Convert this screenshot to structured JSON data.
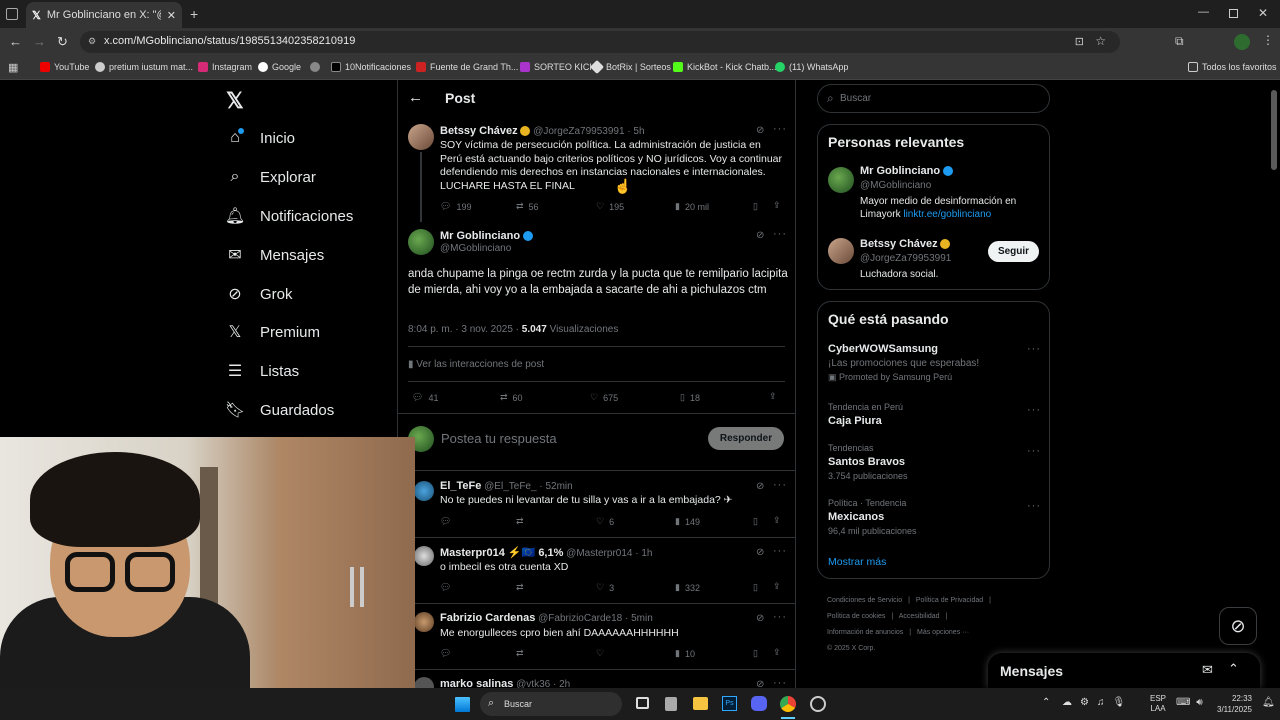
{
  "browser": {
    "tab_title": "Mr Goblinciano en X: \"@JorgeZ",
    "url": "x.com/MGoblinciano/status/1985513402358210919",
    "bookmarks": [
      "YouTube",
      "pretium iustum mat...",
      "Instagram",
      "Google",
      "",
      "10Notificaciones",
      "Fuente de Grand Th...",
      "SORTEO KICK",
      "BotRix | Sorteos",
      "KickBot - Kick Chatb...",
      "(11) WhatsApp"
    ],
    "all_bookmarks": "Todos los favoritos"
  },
  "nav": {
    "items": [
      "Inicio",
      "Explorar",
      "Notificaciones",
      "Mensajes",
      "Grok",
      "Premium",
      "Listas",
      "Guardados"
    ]
  },
  "header": {
    "title": "Post"
  },
  "parent_tweet": {
    "name": "Betssy Chávez",
    "handle": "@JorgeZa79953991",
    "time": "· 5h",
    "text": "SOY víctima de persecución política. La administración de justicia en Perú está actuando bajo criterios políticos y NO jurídicos. Voy a continuar defendiendo mis derechos en instancias nacionales e internacionales. LUCHARE HASTA EL FINAL",
    "replies": "199",
    "reposts": "56",
    "likes": "195",
    "views": "20 mil"
  },
  "main_tweet": {
    "name": "Mr Goblinciano",
    "handle": "@MGoblinciano",
    "text": "anda chupame la pinga oe rectm zurda y la pucta que te remilpario lacipita de mierda, ahi voy yo a la embajada a sacarte de ahi a pichulazos ctm",
    "timestamp": "8:04 p. m. · 3 nov. 2025 ·",
    "views_count": "5.047",
    "views_label": "Visualizaciones",
    "interactions": "Ver las interacciones de post",
    "replies": "41",
    "reposts": "60",
    "likes": "675",
    "bookmarks": "18"
  },
  "reply_box": {
    "placeholder": "Postea tu respuesta",
    "button": "Responder"
  },
  "replies": [
    {
      "name": "El_TeFe",
      "handle": "@El_TeFe_",
      "time": "· 52min",
      "text": "No te puedes ni levantar de tu silla y vas a ir a la embajada? ✈",
      "replies": "",
      "reposts": "",
      "likes": "6",
      "views": "149"
    },
    {
      "name": "Masterpr014 ⚡🇪🇺 6,1%",
      "handle": "@Masterpr014",
      "time": "· 1h",
      "text": "o imbecil es otra cuenta XD",
      "replies": "",
      "reposts": "",
      "likes": "3",
      "views": "332"
    },
    {
      "name": "Fabrizio Cardenas",
      "handle": "@FabrizioCarde18",
      "time": "· 5min",
      "text": "Me enorgulleces cpro bien ahí DAAAAAAHHHHHH",
      "replies": "",
      "reposts": "",
      "likes": "",
      "views": "10"
    },
    {
      "name": "marko salinas",
      "handle": "@vtk36",
      "time": "· 2h",
      "text": "",
      "replies": "",
      "reposts": "",
      "likes": "",
      "views": ""
    }
  ],
  "search": {
    "placeholder": "Buscar"
  },
  "relevant": {
    "title": "Personas relevantes",
    "people": [
      {
        "name": "Mr Goblinciano",
        "handle": "@MGoblinciano",
        "bio": "Mayor medio de desinformación en Limayork",
        "link": "linktr.ee/goblinciano"
      },
      {
        "name": "Betssy Chávez",
        "handle": "@JorgeZa79953991",
        "bio": "Luchadora social.",
        "follow": "Seguir"
      }
    ]
  },
  "trends": {
    "title": "Qué está pasando",
    "items": [
      {
        "meta": "",
        "name": "CyberWOWSamsung",
        "sub": "¡Las promociones que esperabas!",
        "extra": "Promoted by Samsung Perú"
      },
      {
        "meta": "Tendencia en Perú",
        "name": "Caja Piura",
        "sub": ""
      },
      {
        "meta": "Tendencias",
        "name": "Santos Bravos",
        "sub": "3.754 publicaciones"
      },
      {
        "meta": "Política · Tendencia",
        "name": "Mexicanos",
        "sub": "96,4 mil publicaciones"
      }
    ],
    "more": "Mostrar más"
  },
  "footer": {
    "links": [
      "Condiciones de Servicio",
      "|",
      "Política de Privacidad",
      "|",
      "Política de cookies",
      "|",
      "Accesibilidad",
      "|",
      "Información de anuncios",
      "|",
      "Más opciones ···"
    ],
    "copyright": "© 2025 X Corp."
  },
  "messages_drawer": {
    "title": "Mensajes"
  },
  "taskbar": {
    "search": "Buscar",
    "lang1": "ESP",
    "lang2": "LAA",
    "time": "22:33",
    "date": "3/11/2025"
  },
  "colors": {
    "accent": "#1d9bf0",
    "verified": "#1d9bf0",
    "gold": "#e8b422"
  }
}
